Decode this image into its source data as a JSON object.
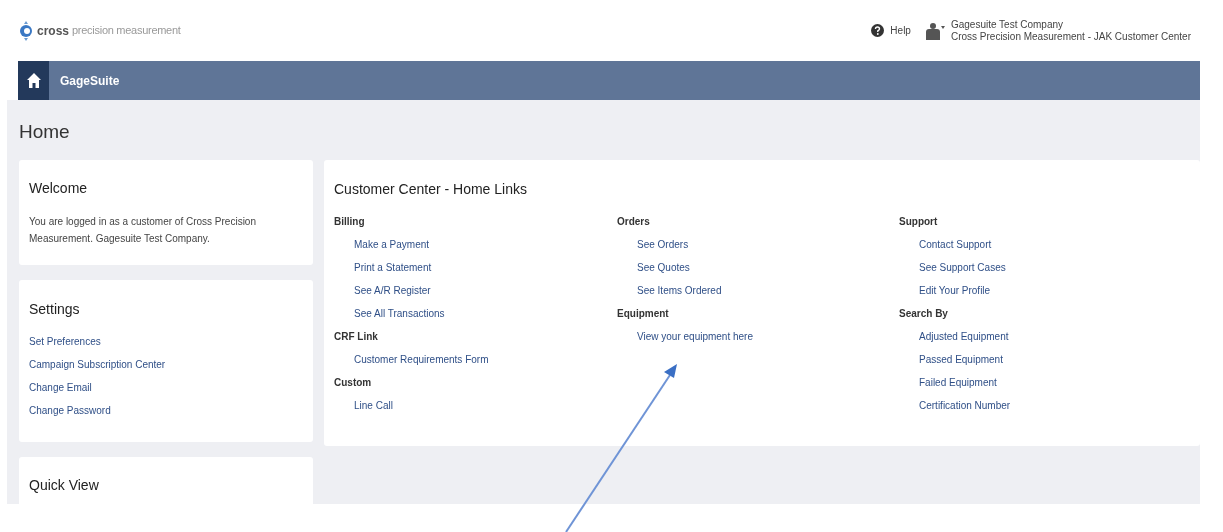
{
  "header": {
    "logo_text": "cross",
    "logo_subtext": "precision measurement",
    "help": "Help",
    "account_company": "Gagesuite Test Company",
    "account_center": "Cross Precision Measurement - JAK Customer Center"
  },
  "navbar": {
    "title": "GageSuite"
  },
  "page_title": "Home",
  "welcome": {
    "title": "Welcome",
    "text": "You are logged in as a customer of Cross Precision Measurement. Gagesuite Test Company."
  },
  "settings": {
    "title": "Settings",
    "links": [
      "Set Preferences",
      "Campaign Subscription Center",
      "Change Email",
      "Change Password"
    ]
  },
  "quick_view": {
    "title": "Quick View"
  },
  "home_links": {
    "title": "Customer Center - Home Links",
    "columns": [
      [
        {
          "heading": "Billing",
          "links": [
            "Make a Payment",
            "Print a Statement",
            "See A/R Register",
            "See All Transactions"
          ]
        },
        {
          "heading": "CRF Link",
          "links": [
            "Customer Requirements Form"
          ]
        },
        {
          "heading": "Custom",
          "links": [
            "Line Call"
          ]
        }
      ],
      [
        {
          "heading": "Orders",
          "links": [
            "See Orders",
            "See Quotes",
            "See Items Ordered"
          ]
        },
        {
          "heading": "Equipment",
          "links": [
            "View your equipment here"
          ]
        }
      ],
      [
        {
          "heading": "Support",
          "links": [
            "Contact Support",
            "See Support Cases",
            "Edit Your Profile"
          ]
        },
        {
          "heading": "Search By",
          "links": [
            "Adjusted Equipment",
            "Passed Equipment",
            "Failed Equipment",
            "Certification Number"
          ]
        }
      ]
    ]
  }
}
